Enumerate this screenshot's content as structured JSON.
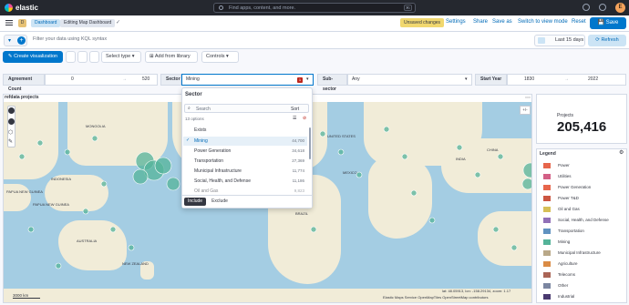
{
  "app": {
    "logo": "elastic",
    "search_placeholder": "Find apps, content, and more.",
    "kbd": "⌘/",
    "avatar": "E"
  },
  "breadcrumbs": {
    "badge": "D",
    "items": [
      "Dashboard",
      "Editing Map Dashboard"
    ]
  },
  "header": {
    "unsaved": "Unsaved changes",
    "settings": "Settings",
    "share": "Share",
    "add": "Save as",
    "switch": "Switch to view mode",
    "reset": "Reset",
    "save": "Save"
  },
  "query": {
    "placeholder": "Filter your data using KQL syntax",
    "date": "Last 15 days",
    "refresh": "Refresh"
  },
  "toolbar": {
    "create": "Create visualization",
    "select_type": "Select type",
    "add_library": "Add from library",
    "controls": "Controls"
  },
  "controls": {
    "agreement": {
      "label": "Agreement Count",
      "min": "0",
      "max": "520"
    },
    "sector": {
      "label": "Sector",
      "value": "Mining",
      "badge": "1"
    },
    "subsector": {
      "label": "Sub-sector",
      "value": "Any"
    },
    "start_year": {
      "label": "Start Year",
      "min": "1830",
      "max": "2022"
    }
  },
  "dropdown": {
    "title": "Sector",
    "search_placeholder": "Search",
    "sort": "Sort",
    "count": "13 options",
    "exists": "Exists",
    "options": [
      {
        "label": "Mining",
        "count": "44,700",
        "selected": true
      },
      {
        "label": "Power Generation",
        "count": "34,618"
      },
      {
        "label": "Transportation",
        "count": "27,369"
      },
      {
        "label": "Municipal Infrastructure",
        "count": "11,774"
      },
      {
        "label": "Social, Health, and Defense",
        "count": "11,186"
      },
      {
        "label": "Oil and Gas",
        "count": "9,823"
      }
    ],
    "include": "Include",
    "exclude": "Exclude"
  },
  "map": {
    "title": "refdata projects",
    "scale": "3000 km",
    "coords": "lat: 48.05913, lon: -158.29134, zoom: 1.17",
    "attribution": "Elastic Maps Service  OpenMapTiles  OpenStreetMap contributors",
    "labels": [
      {
        "text": "PAPUA NEW GUINEA"
      },
      {
        "text": "PAPUA NEW GUINEA"
      },
      {
        "text": "INDONESIA"
      },
      {
        "text": "MONGOLIA"
      },
      {
        "text": "AUSTRALIA"
      },
      {
        "text": "NEW ZEALAND"
      },
      {
        "text": "UNITED STATES"
      },
      {
        "text": "MEXICO"
      },
      {
        "text": "BRAZIL"
      },
      {
        "text": "PERU"
      },
      {
        "text": "INDIA"
      },
      {
        "text": "CHINA"
      }
    ]
  },
  "metric": {
    "label": "Projects",
    "value": "205,416"
  },
  "legend": {
    "title": "Legend",
    "items": [
      {
        "label": "Power",
        "color": "#e7664c"
      },
      {
        "label": "Utilities",
        "color": "#d36086"
      },
      {
        "label": "Power Generation",
        "color": "#e7664c"
      },
      {
        "label": "Power T&D",
        "color": "#cc5642"
      },
      {
        "label": "Oil and Gas",
        "color": "#d6bf57"
      },
      {
        "label": "Social, Health, and Defense",
        "color": "#9170b8"
      },
      {
        "label": "Transportation",
        "color": "#6092c0"
      },
      {
        "label": "Mining",
        "color": "#54b399"
      },
      {
        "label": "Municipal Infrastructure",
        "color": "#b9a888"
      },
      {
        "label": "Agriculture",
        "color": "#da8b45"
      },
      {
        "label": "Telecoms",
        "color": "#aa6556"
      },
      {
        "label": "Other",
        "color": "#7b86a1"
      },
      {
        "label": "Industrial",
        "color": "#4a3a70"
      }
    ]
  }
}
